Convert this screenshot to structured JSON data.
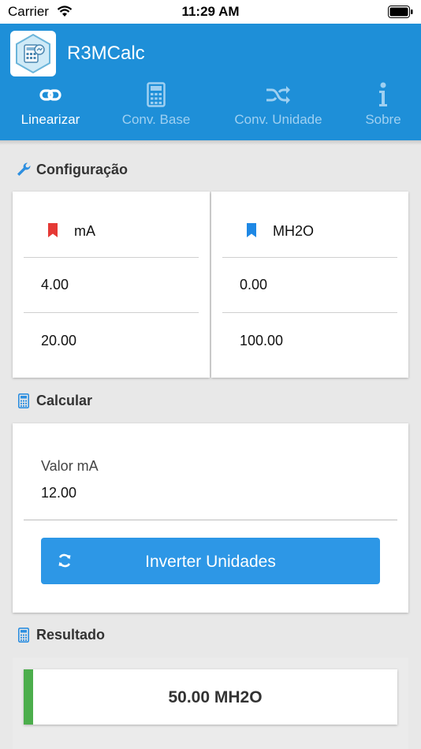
{
  "status_bar": {
    "carrier": "Carrier",
    "time": "11:29 AM"
  },
  "app": {
    "title": "R3MCalc"
  },
  "tabs": [
    {
      "label": "Linearizar",
      "icon": "link-icon",
      "active": true
    },
    {
      "label": "Conv. Base",
      "icon": "calculator-icon",
      "active": false
    },
    {
      "label": "Conv. Unidade",
      "icon": "shuffle-icon",
      "active": false
    },
    {
      "label": "Sobre",
      "icon": "info-icon",
      "active": false
    }
  ],
  "config": {
    "title": "Configuração",
    "left": {
      "unit": "mA",
      "min": "4.00",
      "max": "20.00",
      "color": "#e53935"
    },
    "right": {
      "unit": "MH2O",
      "min": "0.00",
      "max": "100.00",
      "color": "#1e88e5"
    }
  },
  "calculate": {
    "title": "Calcular",
    "field_label": "Valor mA",
    "field_value": "12.00",
    "invert_button": "Inverter Unidades"
  },
  "result": {
    "title": "Resultado",
    "value": "50.00 MH2O",
    "bar_color": "#4cae4c"
  },
  "colors": {
    "primary": "#1e8fd8",
    "button": "#2d97e6"
  }
}
